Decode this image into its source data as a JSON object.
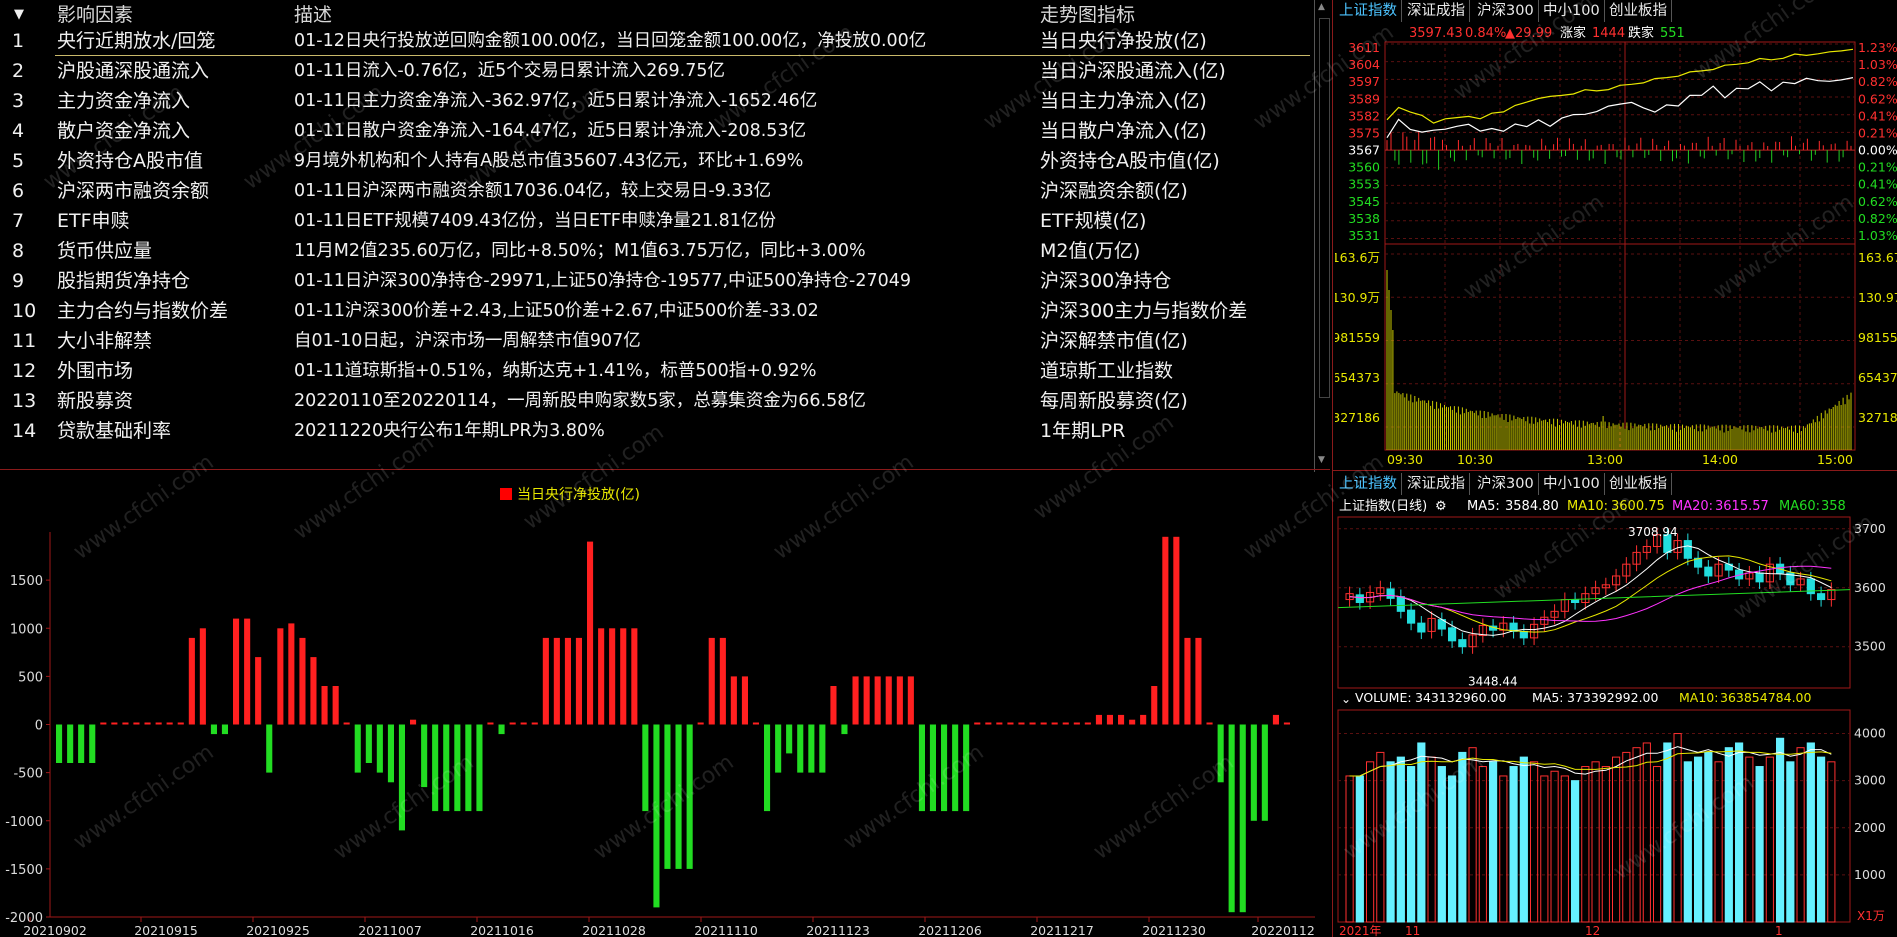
{
  "table": {
    "header": {
      "collapse_icon": "chevron-down",
      "name": "影响因素",
      "desc": "描述",
      "indicator": "走势图指标"
    },
    "rows": [
      {
        "idx": "1",
        "name": "央行近期放水/回笼",
        "desc": "01-12日央行投放逆回购金额100.00亿，当日回笼金额100.00亿，净投放0.00亿",
        "indicator": "当日央行净投放(亿)"
      },
      {
        "idx": "2",
        "name": "沪股通深股通流入",
        "desc": "01-11日流入-0.76亿，近5个交易日累计流入269.75亿",
        "indicator": "当日沪深股通流入(亿)"
      },
      {
        "idx": "3",
        "name": "主力资金净流入",
        "desc": "01-11日主力资金净流入-362.97亿，近5日累计净流入-1652.46亿",
        "indicator": "当日主力净流入(亿)"
      },
      {
        "idx": "4",
        "name": "散户资金净流入",
        "desc": "01-11日散户资金净流入-164.47亿，近5日累计净流入-208.53亿",
        "indicator": "当日散户净流入(亿)"
      },
      {
        "idx": "5",
        "name": "外资持仓A股市值",
        "desc": "9月境外机构和个人持有A股总市值35607.43亿元，环比+1.69%",
        "indicator": "外资持仓A股市值(亿)"
      },
      {
        "idx": "6",
        "name": "沪深两市融资余额",
        "desc": "01-11日沪深两市融资余额17036.04亿，较上交易日-9.33亿",
        "indicator": "沪深融资余额(亿)"
      },
      {
        "idx": "7",
        "name": "ETF申赎",
        "desc": "01-11日ETF规模7409.43亿份，当日ETF申赎净量21.81亿份",
        "indicator": "ETF规模(亿)"
      },
      {
        "idx": "8",
        "name": "货币供应量",
        "desc": "11月M2值235.60万亿，同比+8.50%；M1值63.75万亿，同比+3.00%",
        "indicator": "M2值(万亿)"
      },
      {
        "idx": "9",
        "name": "股指期货净持仓",
        "desc": "01-11日沪深300净持仓-29971,上证50净持仓-19577,中证500净持仓-27049",
        "indicator": "沪深300净持仓"
      },
      {
        "idx": "10",
        "name": "主力合约与指数价差",
        "desc": "01-11沪深300价差+2.43,上证50价差+2.67,中证500价差-33.02",
        "indicator": "沪深300主力与指数价差"
      },
      {
        "idx": "11",
        "name": "大小非解禁",
        "desc": "自01-10日起，沪深市场一周解禁市值907亿",
        "indicator": "沪深解禁市值(亿)"
      },
      {
        "idx": "12",
        "name": "外围市场",
        "desc": "01-11道琼斯指+0.51%，纳斯达克+1.41%，标普500指+0.92%",
        "indicator": "道琼斯工业指数"
      },
      {
        "idx": "13",
        "name": "新股募资",
        "desc": "20220110至20220114，一周新股申购家数5家，总募集资金为66.58亿",
        "indicator": "每周新股募资(亿)"
      },
      {
        "idx": "14",
        "name": "贷款基础利率",
        "desc": "20211220央行公布1年期LPR为3.80%",
        "indicator": "1年期LPR"
      }
    ]
  },
  "watermark": "www.cfchi.com",
  "colors": {
    "up": "#ff2a2a",
    "down": "#22dd22",
    "yellow": "#e8e800",
    "white": "#ffffff",
    "cyan": "#66f0ff",
    "magenta": "#ff33ff",
    "axis_red": "#a01818",
    "tab_active": "#4cc3ff"
  },
  "chart_data": [
    {
      "type": "bar",
      "title": "当日央行净投放(亿)",
      "legend_color": "#ff0000",
      "ylim": [
        -2000,
        2000
      ],
      "yticks": [
        "1500",
        "1000",
        "500",
        "0",
        "-500",
        "-1000",
        "-1500",
        "-2000"
      ],
      "ytick_values": [
        1500,
        1000,
        500,
        0,
        -500,
        -1000,
        -1500,
        -2000
      ],
      "xticks": [
        "20210902",
        "20210915",
        "20210925",
        "20211007",
        "20211016",
        "20211028",
        "20211110",
        "20211123",
        "20211206",
        "20211217",
        "20211230",
        "20220112"
      ],
      "values": [
        -400,
        -400,
        -400,
        -400,
        10,
        10,
        10,
        10,
        10,
        10,
        10,
        10,
        900,
        1000,
        -100,
        -100,
        1100,
        1100,
        700,
        -500,
        1000,
        1050,
        900,
        700,
        400,
        400,
        10,
        -500,
        -400,
        -500,
        -600,
        -1100,
        50,
        -650,
        -900,
        -900,
        -900,
        -900,
        -900,
        0,
        -100,
        10,
        10,
        10,
        900,
        900,
        900,
        900,
        1900,
        1000,
        1000,
        1000,
        1000,
        -900,
        -1900,
        -1500,
        -1500,
        -1500,
        0,
        900,
        900,
        500,
        500,
        10,
        -900,
        -500,
        -300,
        -500,
        -500,
        -500,
        400,
        -100,
        500,
        500,
        500,
        500,
        500,
        500,
        -900,
        -900,
        -900,
        -900,
        -900,
        10,
        10,
        10,
        10,
        10,
        10,
        10,
        10,
        10,
        10,
        10,
        100,
        100,
        100,
        50,
        100,
        400,
        1950,
        1950,
        900,
        900,
        10,
        -600,
        -1950,
        -1950,
        -1000,
        -1000,
        100,
        10
      ]
    },
    {
      "type": "line",
      "title": "上证指数 分时",
      "header_price": "3597.43",
      "header_pct": "0.84%",
      "header_chg": "▲29.99",
      "header_up_label": "涨家",
      "header_up": "1444",
      "header_down_label": "跌家",
      "header_down": "551",
      "price_ticks": [
        "3611",
        "3604",
        "3597",
        "3589",
        "3582",
        "3575",
        "3567",
        "3560",
        "3553",
        "3545",
        "3538",
        "3531"
      ],
      "price_tick_values": [
        3611,
        3604,
        3597,
        3589,
        3582,
        3575,
        3567,
        3560,
        3553,
        3545,
        3538,
        3531
      ],
      "pct_ticks": [
        "1.23%",
        "1.03%",
        "0.82%",
        "0.62%",
        "0.41%",
        "0.21%",
        "0.00%",
        "0.21%",
        "0.41%",
        "0.62%",
        "0.82%",
        "1.03%"
      ],
      "vol_ticks": [
        "163.6万",
        "130.9万",
        "981559",
        "654373",
        "327186"
      ],
      "vol_tick_values": [
        1636000,
        1309000,
        981559,
        654373,
        327186
      ],
      "vol_ticks_right": [
        "163.67",
        "130.97",
        "981559",
        "654373",
        "327186"
      ],
      "xticks": [
        "09:30",
        "10:30",
        "13:00",
        "14:00",
        "15:00"
      ],
      "ylim": [
        3527,
        3614
      ],
      "series": [
        {
          "color": "#e8e800",
          "values": [
            3580,
            3586,
            3583,
            3582,
            3579,
            3580,
            3581,
            3582,
            3580,
            3583,
            3584,
            3586,
            3588,
            3590,
            3590,
            3591,
            3592,
            3593,
            3593,
            3594,
            3595,
            3596,
            3597,
            3598,
            3599,
            3600,
            3601,
            3602,
            3603,
            3604,
            3605,
            3606,
            3607,
            3607,
            3608,
            3609,
            3609,
            3610,
            3610,
            3611,
            3612
          ]
        },
        {
          "color": "#ffffff",
          "values": [
            3572,
            3580,
            3576,
            3574,
            3576,
            3575,
            3578,
            3577,
            3576,
            3575,
            3576,
            3577,
            3578,
            3579,
            3578,
            3580,
            3583,
            3582,
            3584,
            3586,
            3587,
            3588,
            3585,
            3584,
            3586,
            3587,
            3590,
            3592,
            3594,
            3591,
            3593,
            3595,
            3596,
            3594,
            3596,
            3597,
            3598,
            3598,
            3597,
            3598,
            3599
          ]
        }
      ]
    },
    {
      "type": "candlestick",
      "title": "上证指数(日线)",
      "ma5_label": "MA5:",
      "ma5": "3584.80",
      "ma10_label": "MA10:",
      "ma10": "3600.75",
      "ma20_label": "MA20:",
      "ma20": "3615.57",
      "ma60_label": "MA60:",
      "ma60": "358",
      "high_label": "3708.94",
      "low_label": "3448.44",
      "yticks": [
        "370",
        "360",
        "350"
      ],
      "ytick_values": [
        3700,
        3600,
        3500
      ],
      "ylim": [
        3430,
        3720
      ],
      "candles": [
        [
          3580,
          3590
        ],
        [
          3588,
          3575
        ],
        [
          3576,
          3592
        ],
        [
          3590,
          3600
        ],
        [
          3598,
          3582
        ],
        [
          3585,
          3560
        ],
        [
          3562,
          3540
        ],
        [
          3540,
          3525
        ],
        [
          3526,
          3548
        ],
        [
          3546,
          3530
        ],
        [
          3532,
          3510
        ],
        [
          3512,
          3500
        ],
        [
          3500,
          3520
        ],
        [
          3519,
          3536
        ],
        [
          3535,
          3528
        ],
        [
          3528,
          3540
        ],
        [
          3540,
          3526
        ],
        [
          3526,
          3515
        ],
        [
          3515,
          3538
        ],
        [
          3538,
          3550
        ],
        [
          3550,
          3560
        ],
        [
          3560,
          3580
        ],
        [
          3580,
          3575
        ],
        [
          3575,
          3590
        ],
        [
          3590,
          3600
        ],
        [
          3600,
          3605
        ],
        [
          3605,
          3620
        ],
        [
          3620,
          3640
        ],
        [
          3640,
          3660
        ],
        [
          3660,
          3670
        ],
        [
          3670,
          3690
        ],
        [
          3690,
          3660
        ],
        [
          3660,
          3680
        ],
        [
          3680,
          3650
        ],
        [
          3650,
          3635
        ],
        [
          3635,
          3620
        ],
        [
          3620,
          3640
        ],
        [
          3640,
          3630
        ],
        [
          3630,
          3615
        ],
        [
          3615,
          3625
        ],
        [
          3625,
          3610
        ],
        [
          3610,
          3640
        ],
        [
          3640,
          3625
        ],
        [
          3625,
          3605
        ],
        [
          3605,
          3615
        ],
        [
          3615,
          3590
        ],
        [
          3590,
          3580
        ],
        [
          3580,
          3597
        ]
      ]
    },
    {
      "type": "bar",
      "title": "VOLUME",
      "volume_label": "VOLUME:",
      "volume": "343132960.00",
      "ma5_label": "MA5:",
      "ma5": "373392992.00",
      "ma10_label": "MA10:",
      "ma10": "363854784.00",
      "yticks": [
        "4000",
        "3000",
        "2000",
        "1000"
      ],
      "ytick_values": [
        4000,
        3000,
        2000,
        1000
      ],
      "unit": "X1万",
      "xticks": [
        "2021年",
        "11",
        "12",
        "1"
      ],
      "ylim": [
        0,
        4500
      ],
      "values": [
        3100,
        3100,
        3400,
        3600,
        3400,
        3500,
        3300,
        3800,
        3500,
        3300,
        3100,
        3600,
        3700,
        3300,
        3400,
        3100,
        3300,
        3500,
        3400,
        3100,
        3200,
        3100,
        3000,
        3300,
        3400,
        3300,
        3500,
        3600,
        3700,
        3800,
        3300,
        3800,
        4000,
        3400,
        3500,
        3600,
        3400,
        3700,
        3800,
        3500,
        3300,
        3500,
        3900,
        3400,
        3700,
        3800,
        3500,
        3400
      ]
    }
  ],
  "right_tabs": {
    "top": [
      "上证指数",
      "深证成指",
      "沪深300",
      "中小100",
      "创业板指"
    ],
    "bottom": [
      "上证指数",
      "深证成指",
      "沪深300",
      "中小100",
      "创业板指"
    ]
  }
}
